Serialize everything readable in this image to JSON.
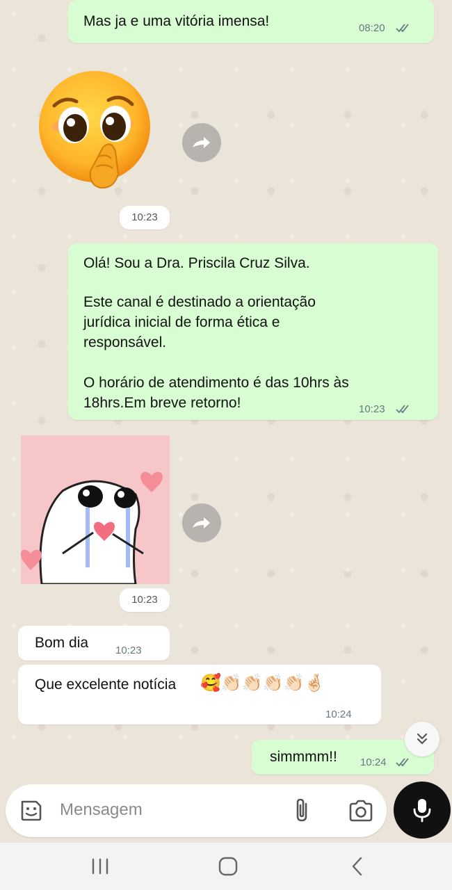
{
  "messages": {
    "m1": {
      "text": "Mas ja e uma vitória imensa!",
      "time": "08:20"
    },
    "sticker1": {
      "name": "pleading-face-sticker",
      "time": "10:23"
    },
    "m2": {
      "line1": "Olá! Sou a Dra. Priscila Cruz Silva.",
      "line2": "Este canal é destinado a orientação",
      "line3": "jurídica inicial de forma ética e",
      "line4": "responsável.",
      "line5": "O horário de atendimento é das 10hrs às",
      "line6": "18hrs.Em breve retorno!",
      "time": "10:23"
    },
    "sticker2": {
      "name": "crying-heart-sticker",
      "time": "10:23"
    },
    "m3": {
      "text": "Bom dia",
      "time": "10:23"
    },
    "m4": {
      "text": "Que excelente notícia",
      "emojis": "🥰👏🏻👏🏻👏🏻👏🏻🤞🏻",
      "time": "10:24"
    },
    "m5": {
      "text": "simmmm!!",
      "time": "10:24"
    }
  },
  "composer": {
    "placeholder": "Mensagem"
  },
  "colors": {
    "outgoing": "#d9fdd3",
    "incoming": "#ffffff",
    "ticks": "#667781"
  },
  "icons": [
    "sticker-icon",
    "attach-icon",
    "camera-icon",
    "mic-icon",
    "forward-icon",
    "scroll-down-icon",
    "recents-icon",
    "home-icon",
    "back-icon"
  ]
}
